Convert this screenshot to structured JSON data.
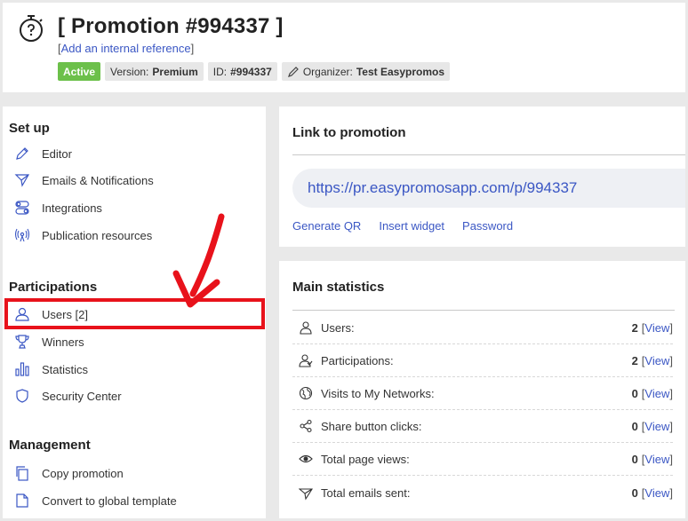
{
  "header": {
    "title": "[ Promotion #994337 ]",
    "ref_open": "[",
    "ref_link": "Add an internal reference",
    "ref_close": "]",
    "status_badge": "Active",
    "version_label": "Version:",
    "version_value": "Premium",
    "id_label": "ID:",
    "id_value": "#994337",
    "organizer_label": "Organizer:",
    "organizer_value": "Test Easypromos"
  },
  "sidebar": {
    "setup_title": "Set up",
    "setup_items": [
      {
        "label": "Editor",
        "icon": "pencil-icon"
      },
      {
        "label": "Emails & Notifications",
        "icon": "send-icon"
      },
      {
        "label": "Integrations",
        "icon": "toggles-icon"
      },
      {
        "label": "Publication resources",
        "icon": "broadcast-icon"
      }
    ],
    "participations_title": "Participations",
    "participations_items": [
      {
        "label": "Users [2]",
        "icon": "user-icon"
      },
      {
        "label": "Winners",
        "icon": "trophy-icon"
      },
      {
        "label": "Statistics",
        "icon": "bar-chart-icon"
      },
      {
        "label": "Security Center",
        "icon": "shield-icon"
      }
    ],
    "management_title": "Management",
    "management_items": [
      {
        "label": "Copy promotion",
        "icon": "copy-icon"
      },
      {
        "label": "Convert to global template",
        "icon": "document-icon"
      }
    ]
  },
  "link_panel": {
    "title": "Link to promotion",
    "url": "https://pr.easypromosapp.com/p/994337",
    "actions": [
      "Generate QR",
      "Insert widget",
      "Password"
    ]
  },
  "stats_panel": {
    "title": "Main statistics",
    "rows": [
      {
        "label": "Users:",
        "value": "2",
        "view": "View",
        "icon": "user-icon"
      },
      {
        "label": "Participations:",
        "value": "2",
        "view": "View",
        "icon": "participations-icon"
      },
      {
        "label": "Visits to My Networks:",
        "value": "0",
        "view": "View",
        "icon": "globe-icon"
      },
      {
        "label": "Share button clicks:",
        "value": "0",
        "view": "View",
        "icon": "share-icon"
      },
      {
        "label": "Total page views:",
        "value": "0",
        "view": "View",
        "icon": "eye-icon"
      },
      {
        "label": "Total emails sent:",
        "value": "0",
        "view": "View",
        "icon": "send-icon"
      }
    ]
  },
  "colors": {
    "accent": "#3b57c4",
    "active": "#6cc04a",
    "highlight": "#e8121b",
    "background": "#e9e9e9"
  }
}
